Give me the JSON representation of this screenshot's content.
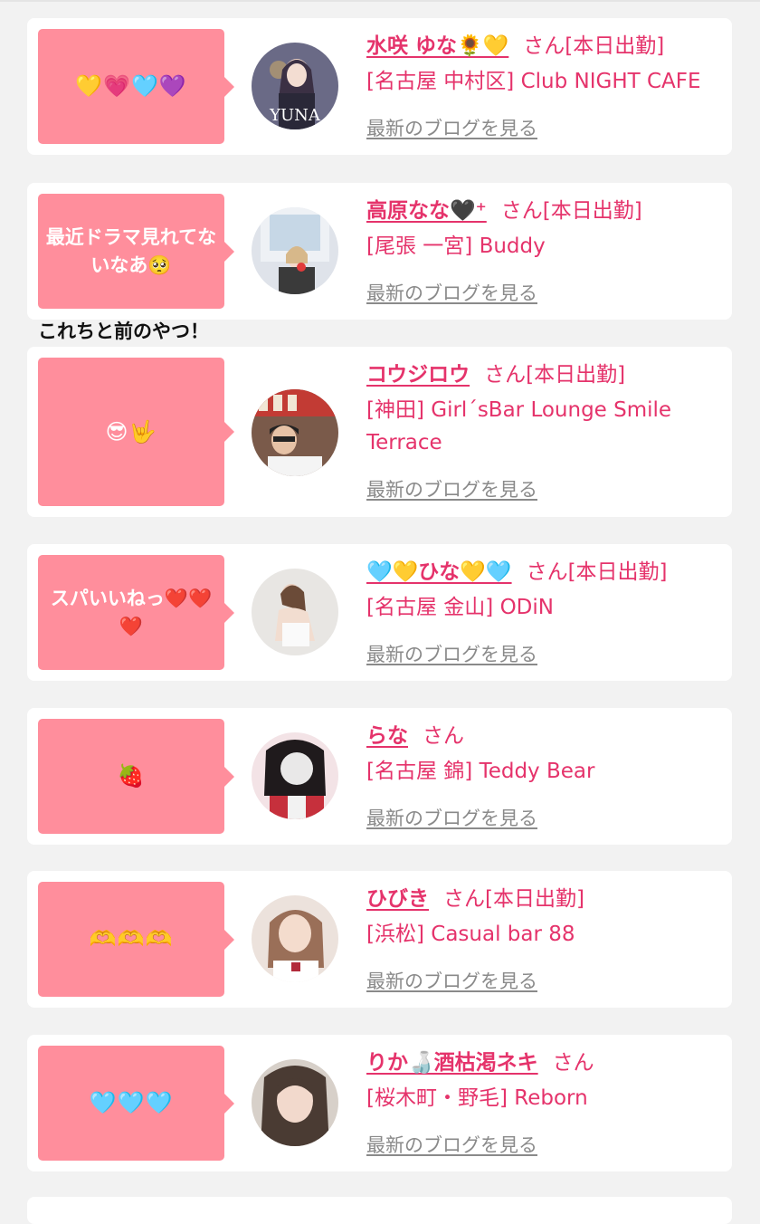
{
  "annotation": "これちと前のやつ！",
  "blog_link_label": "最新のブログを見る",
  "entries": [
    {
      "bubble": "💛💗🩵💜",
      "name": "水咲 ゆな🌻💛",
      "honorific": "さん",
      "badge": "[本日出勤]",
      "shop": "[名古屋 中村区] Club NIGHT CAFE",
      "avatar_text": "YUNA"
    },
    {
      "bubble": "最近ドラマ見れてないなあ🥺",
      "name": "高原なな🖤⁺",
      "honorific": "さん",
      "badge": "[本日出勤]",
      "shop": "[尾張 一宮] Buddy",
      "avatar_text": ""
    },
    {
      "bubble": "😎🤟",
      "name": "コウジロウ",
      "honorific": "さん",
      "badge": "[本日出勤]",
      "shop": "[神田] Girl´sBar Lounge Smile Terrace",
      "avatar_text": ""
    },
    {
      "bubble": "スパいいねっ❤️❤️❤️",
      "name": "🩵💛ひな💛🩵",
      "honorific": "さん",
      "badge": "[本日出勤]",
      "shop": "[名古屋 金山] ODiN",
      "avatar_text": ""
    },
    {
      "bubble": "🍓",
      "name": "らな",
      "honorific": "さん",
      "badge": "",
      "shop": "[名古屋 錦] Teddy Bear",
      "avatar_text": ""
    },
    {
      "bubble": "🫶🫶🫶",
      "name": "ひびき",
      "honorific": "さん",
      "badge": "[本日出勤]",
      "shop": "[浜松] Casual bar 88",
      "avatar_text": ""
    },
    {
      "bubble": "🩵🩵🩵",
      "name": "りか🍶酒枯渇ネキ",
      "honorific": "さん",
      "badge": "",
      "shop": "[桜木町・野毛] Reborn",
      "avatar_text": ""
    }
  ],
  "colors": {
    "accent": "#e5336b",
    "bubble": "#ff8e9c",
    "link_gray": "#8a8a8a"
  }
}
